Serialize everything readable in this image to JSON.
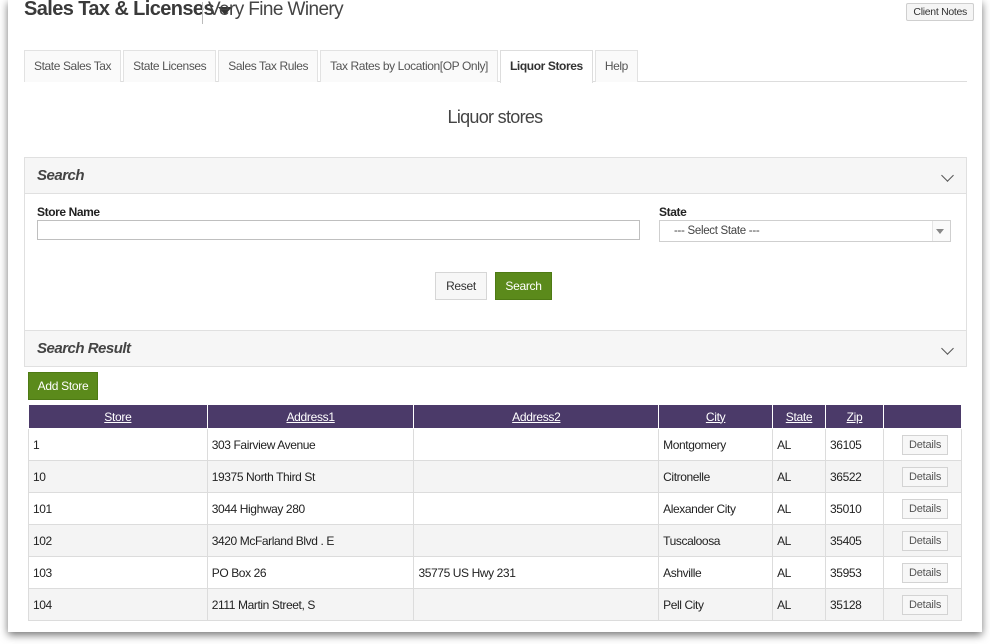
{
  "header": {
    "app_title": "Sales Tax & Licenses",
    "client_name": "Very Fine Winery",
    "client_notes_label": "Client Notes"
  },
  "tabs": [
    {
      "label": "State Sales Tax",
      "active": false
    },
    {
      "label": "State Licenses",
      "active": false
    },
    {
      "label": "Sales Tax Rules",
      "active": false
    },
    {
      "label": "Tax Rates by Location[OP Only]",
      "active": false
    },
    {
      "label": "Liquor Stores",
      "active": true
    },
    {
      "label": "Help",
      "active": false
    }
  ],
  "page_title": "Liquor stores",
  "search_panel": {
    "title": "Search",
    "store_name_label": "Store Name",
    "store_name_value": "",
    "state_label": "State",
    "state_selected": "--- Select State ---",
    "reset_label": "Reset",
    "search_label": "Search"
  },
  "results_panel": {
    "title": "Search Result",
    "add_store_label": "Add Store",
    "columns": [
      "Store",
      "Address1",
      "Address2",
      "City",
      "State",
      "Zip",
      ""
    ],
    "details_label": "Details",
    "rows": [
      {
        "store": "1",
        "address1": "303 Fairview Avenue",
        "address2": "",
        "city": "Montgomery",
        "state": "AL",
        "zip": "36105"
      },
      {
        "store": "10",
        "address1": "19375 North Third St",
        "address2": "",
        "city": "Citronelle",
        "state": "AL",
        "zip": "36522"
      },
      {
        "store": "101",
        "address1": "3044 Highway 280",
        "address2": "",
        "city": "Alexander City",
        "state": "AL",
        "zip": "35010"
      },
      {
        "store": "102",
        "address1": "3420 McFarland Blvd . E",
        "address2": "",
        "city": "Tuscaloosa",
        "state": "AL",
        "zip": "35405"
      },
      {
        "store": "103",
        "address1": "PO Box 26",
        "address2": "35775 US Hwy 231",
        "city": "Ashville",
        "state": "AL",
        "zip": "35953"
      },
      {
        "store": "104",
        "address1": "2111 Martin Street, S",
        "address2": "",
        "city": "Pell City",
        "state": "AL",
        "zip": "35128"
      }
    ]
  }
}
